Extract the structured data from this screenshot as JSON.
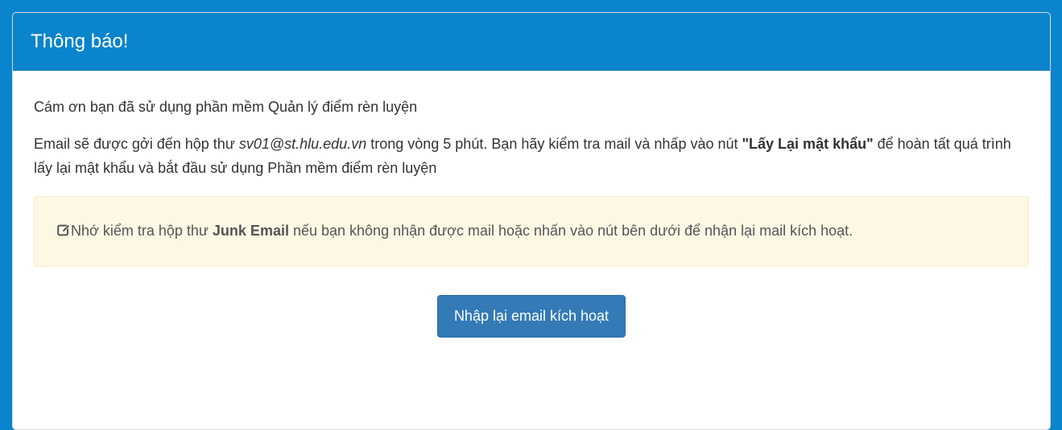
{
  "panel": {
    "title": "Thông báo!"
  },
  "message": {
    "thanks": "Cám ơn bạn đã sử dụng phần mềm Quản lý điểm rèn luyện",
    "email_prefix": "Email sẽ được gởi đến hộp thư ",
    "email_address": "sv01@st.hlu.edu.vn",
    "email_middle": " trong vòng 5 phút. Bạn hãy kiểm tra mail và nhấp vào nút ",
    "button_name": "\"Lấy Lại mật khẩu\"",
    "email_suffix": " để hoàn tất quá trình lấy lại mật khẩu và bắt đầu sử dụng Phần mềm điểm rèn luyện"
  },
  "warning": {
    "icon": "edit-icon",
    "prefix": "Nhớ kiểm tra hộp thư ",
    "highlight": "Junk Email",
    "suffix": " nếu bạn không nhận được mail hoặc nhấn vào nút bên dưới để nhận lại mail kích hoạt."
  },
  "actions": {
    "resend_label": "Nhập lại email kích hoạt"
  },
  "colors": {
    "header": "#0a84cc",
    "button": "#337ab7",
    "warning_bg": "#fcf8e3"
  }
}
